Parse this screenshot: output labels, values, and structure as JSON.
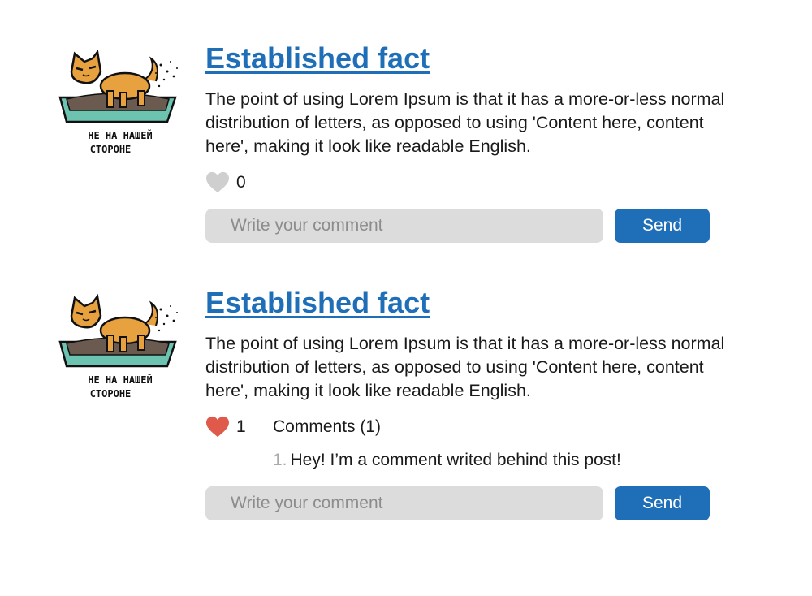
{
  "posts": [
    {
      "title": "Established fact",
      "body": "The point of using Lorem Ipsum is that it has a more-or-less normal distribution of letters, as opposed to using 'Content here, content here', making it look like readable English.",
      "likes": "0",
      "liked": false,
      "comments_label": "",
      "comments": [],
      "thumbnail_caption": [
        "НЕ НА НАШЕЙ",
        "СТОРОНЕ"
      ],
      "comment_placeholder": "Write your comment",
      "send_label": "Send"
    },
    {
      "title": "Established fact",
      "body": "The point of using Lorem Ipsum is that it has a more-or-less normal distribution of letters, as opposed to using 'Content here, content here', making it look like readable English.",
      "likes": "1",
      "liked": true,
      "comments_label": "Comments (1)",
      "comments": [
        {
          "number": "1.",
          "text": "Hey! I’m a comment writed behind this post!"
        }
      ],
      "thumbnail_caption": [
        "НЕ НА НАШЕЙ",
        "СТОРОНЕ"
      ],
      "comment_placeholder": "Write your comment",
      "send_label": "Send"
    }
  ],
  "colors": {
    "link": "#1f6fb8",
    "button": "#1f6fb8",
    "input_bg": "#dcdcdc",
    "heart_off": "#cfcfcf",
    "heart_on": "#e05a4b"
  }
}
